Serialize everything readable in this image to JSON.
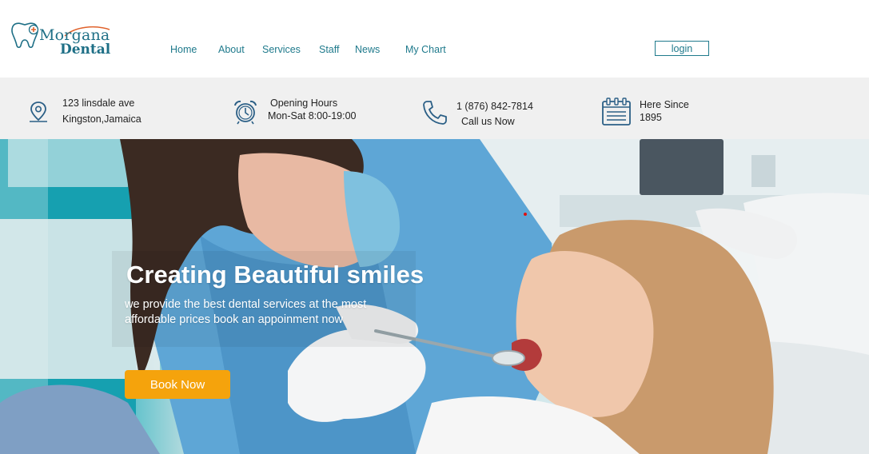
{
  "brand": {
    "name_line1": "Morgana",
    "name_line2": "Dental"
  },
  "nav": {
    "items": [
      {
        "label": "Home"
      },
      {
        "label": "About"
      },
      {
        "label": "Services"
      },
      {
        "label": "Staff"
      },
      {
        "label": "News"
      },
      {
        "label": "My Chart"
      }
    ],
    "login_label": "login"
  },
  "info": {
    "address": {
      "icon": "location-pin-icon",
      "line1": "123 linsdale ave",
      "line2": "Kingston,Jamaica"
    },
    "hours": {
      "icon": "alarm-clock-icon",
      "line1": "Opening Hours",
      "line2": "Mon-Sat 8:00-19:00"
    },
    "phone": {
      "icon": "phone-icon",
      "line1": "1 (876) 842-7814",
      "line2": "Call us Now"
    },
    "since": {
      "icon": "calendar-icon",
      "line1": "Here Since",
      "line2": "1895"
    }
  },
  "hero": {
    "title": "Creating Beautiful smiles",
    "subtitle": "we provide the best dental services at the most affordable prices book an appoinment now",
    "cta_label": "Book Now"
  },
  "colors": {
    "brand": "#1f7a8c",
    "cta": "#f5a30c",
    "infobar_bg": "#f0f0f0"
  }
}
